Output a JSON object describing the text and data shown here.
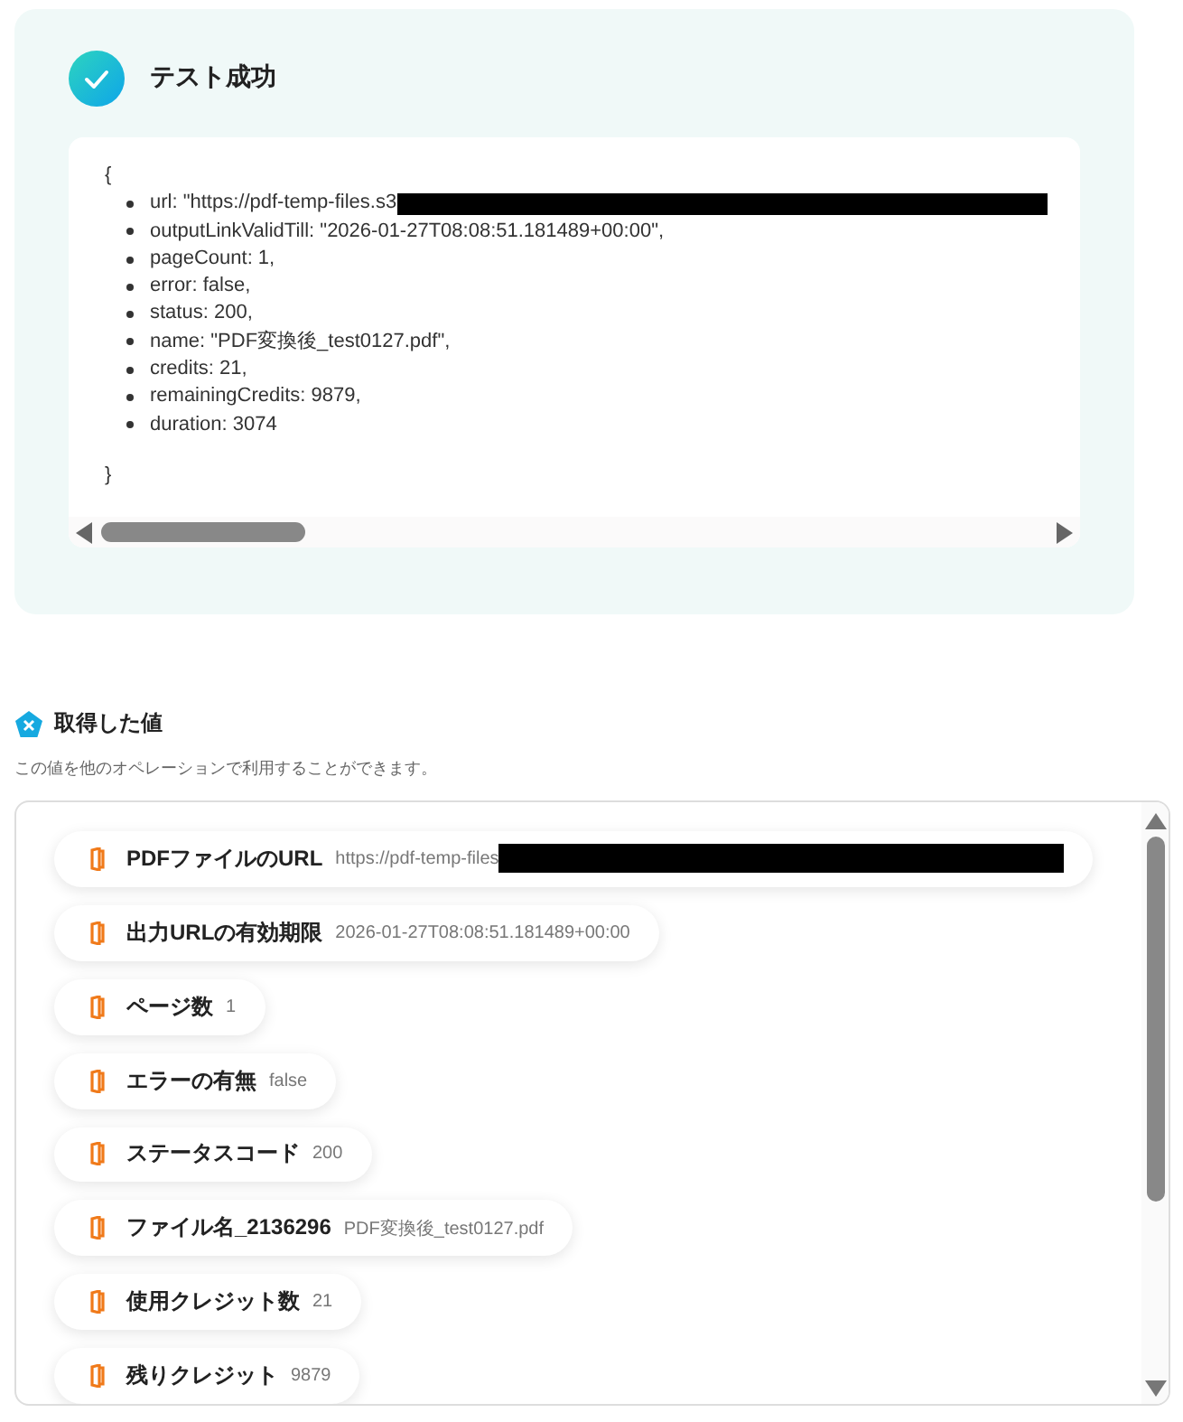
{
  "result": {
    "title": "テスト成功",
    "open_brace": "{",
    "lines": [
      {
        "text": "url: \"https://pdf-temp-files.s3",
        "redacted": true
      },
      {
        "text": "outputLinkValidTill: \"2026-01-27T08:08:51.181489+00:00\",",
        "redacted": false
      },
      {
        "text": "pageCount: 1,",
        "redacted": false
      },
      {
        "text": "error: false,",
        "redacted": false
      },
      {
        "text": "status: 200,",
        "redacted": false
      },
      {
        "text": "name: \"PDF変換後_test0127.pdf\",",
        "redacted": false
      },
      {
        "text": "credits: 21,",
        "redacted": false
      },
      {
        "text": "remainingCredits: 9879,",
        "redacted": false
      },
      {
        "text": "duration: 3074",
        "redacted": false
      }
    ],
    "close_brace": "}"
  },
  "values": {
    "title": "取得した値",
    "description": "この値を他のオペレーションで利用することができます。",
    "items": [
      {
        "label": "PDFファイルのURL",
        "value": "https://pdf-temp-files",
        "redacted": true
      },
      {
        "label": "出力URLの有効期限",
        "value": "2026-01-27T08:08:51.181489+00:00",
        "redacted": false
      },
      {
        "label": "ページ数",
        "value": "1",
        "redacted": false
      },
      {
        "label": "エラーの有無",
        "value": "false",
        "redacted": false
      },
      {
        "label": "ステータスコード",
        "value": "200",
        "redacted": false
      },
      {
        "label": "ファイル名_2136296",
        "value": "PDF変換後_test0127.pdf",
        "redacted": false
      },
      {
        "label": "使用クレジット数",
        "value": "21",
        "redacted": false
      },
      {
        "label": "残りクレジット",
        "value": "9879",
        "redacted": false
      }
    ]
  }
}
